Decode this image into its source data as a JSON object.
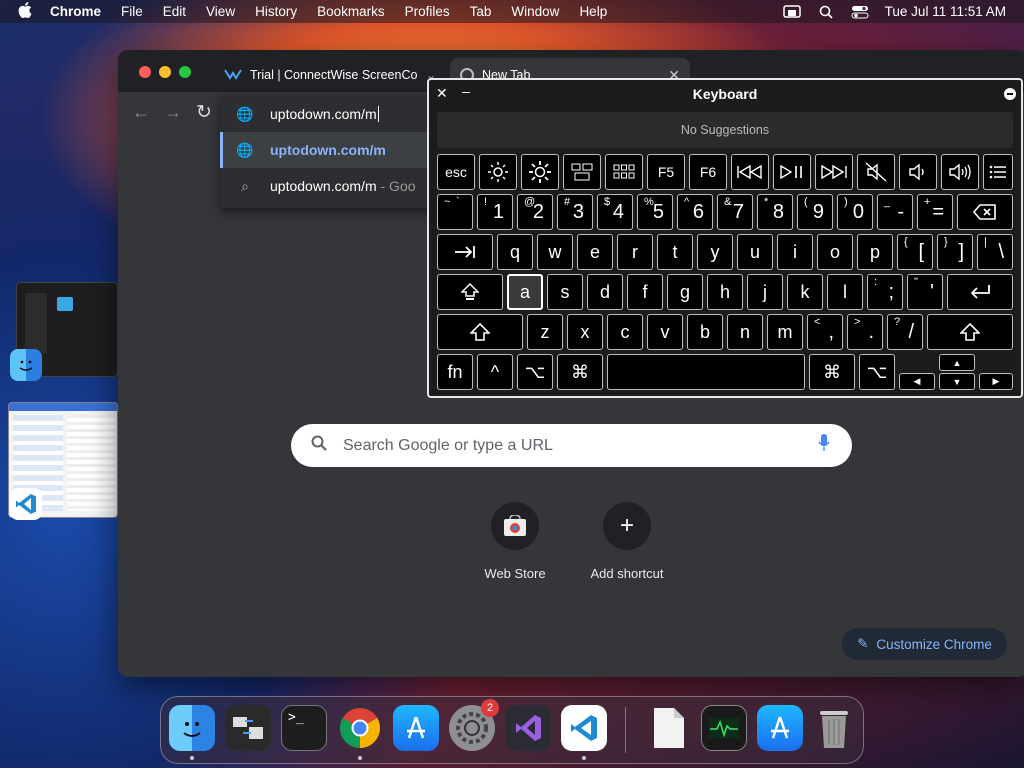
{
  "menubar": {
    "app_name": "Chrome",
    "items": [
      "File",
      "Edit",
      "View",
      "History",
      "Bookmarks",
      "Profiles",
      "Tab",
      "Window",
      "Help"
    ],
    "datetime": "Tue Jul 11  11:51 AM"
  },
  "browser": {
    "tabs": [
      {
        "title": "Trial | ConnectWise ScreenCon"
      },
      {
        "title": "New Tab"
      }
    ],
    "omnibox": {
      "value": "uptodown.com/m",
      "suggestions": [
        {
          "text": "uptodown.com/m"
        },
        {
          "text": "uptodown.com/m",
          "suffix": " - Goo"
        }
      ]
    },
    "search": {
      "placeholder": "Search Google or type a URL"
    },
    "shortcuts": [
      {
        "label": "Web Store"
      },
      {
        "label": "Add shortcut"
      }
    ],
    "customize_label": "Customize Chrome"
  },
  "keyboard": {
    "title": "Keyboard",
    "suggestions": "No Suggestions",
    "fn_row": [
      "esc",
      "brightness-down",
      "brightness-up",
      "mission-control",
      "launchpad",
      "F5",
      "F6",
      "rewind",
      "play-pause",
      "fast-forward",
      "mute",
      "volume-down",
      "volume-up",
      "list"
    ],
    "fn_text": {
      "esc": "esc",
      "f5": "F5",
      "f6": "F6"
    },
    "number_row": [
      {
        "top": "~",
        "top2": "`",
        "main": ""
      },
      {
        "top": "!",
        "main": "1"
      },
      {
        "top": "@",
        "main": "2"
      },
      {
        "top": "#",
        "main": "3"
      },
      {
        "top": "$",
        "main": "4"
      },
      {
        "top": "%",
        "main": "5"
      },
      {
        "top": "^",
        "main": "6"
      },
      {
        "top": "&",
        "main": "7"
      },
      {
        "top": "*",
        "main": "8"
      },
      {
        "top": "(",
        "main": "9"
      },
      {
        "top": ")",
        "main": "0"
      },
      {
        "top": "_",
        "main": "-"
      },
      {
        "top": "+",
        "main": "="
      }
    ],
    "qwerty_row": [
      "q",
      "w",
      "e",
      "r",
      "t",
      "y",
      "u",
      "i",
      "o",
      "p"
    ],
    "bracket_keys": [
      {
        "top": "{",
        "main": "["
      },
      {
        "top": "}",
        "main": "]"
      },
      {
        "top": "|",
        "main": "\\"
      }
    ],
    "home_row": [
      "a",
      "s",
      "d",
      "f",
      "g",
      "h",
      "j",
      "k",
      "l"
    ],
    "home_punct": [
      {
        "top": ":",
        "main": ";"
      },
      {
        "top": "\"",
        "main": "'"
      }
    ],
    "bottom_row": [
      "z",
      "x",
      "c",
      "v",
      "b",
      "n",
      "m"
    ],
    "bottom_punct": [
      {
        "top": "<",
        "main": ","
      },
      {
        "top": ">",
        "main": "."
      },
      {
        "top": "?",
        "main": "/"
      }
    ],
    "mod_row": {
      "fn": "fn",
      "ctrl": "^",
      "opt": "⌥",
      "cmd": "⌘"
    }
  },
  "dock": {
    "items": [
      "Finder",
      "Migration Assistant",
      "Terminal",
      "Google Chrome",
      "App Store",
      "System Settings",
      "Visual Studio",
      "Visual Studio Code",
      "Document",
      "Activity Monitor",
      "App Store",
      "Trash"
    ],
    "badge": "2"
  }
}
